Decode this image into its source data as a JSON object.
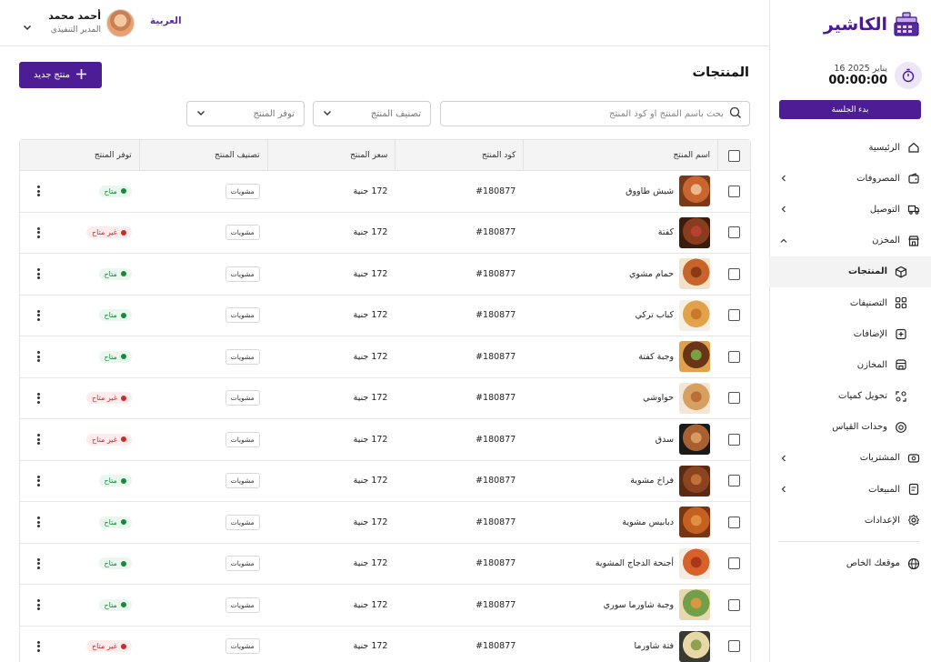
{
  "sidebar": {
    "brand": "الكاشير",
    "session": {
      "date": "16 يناير 2025",
      "time": "00:00:00",
      "start_label": "بدء الجلسة"
    },
    "items": [
      {
        "label": "الرئيسية",
        "icon": "home-icon",
        "chevron": "none",
        "level": 0,
        "active": false
      },
      {
        "label": "المصروفات",
        "icon": "wallet-icon",
        "chevron": "left",
        "level": 0,
        "active": false
      },
      {
        "label": "التوصيل",
        "icon": "truck-icon",
        "chevron": "left",
        "level": 0,
        "active": false
      },
      {
        "label": "المخزن",
        "icon": "store-icon",
        "chevron": "up",
        "level": 0,
        "active": false
      },
      {
        "label": "المنتجات",
        "icon": "box-icon",
        "chevron": "none",
        "level": 1,
        "active": true
      },
      {
        "label": "التصنيفات",
        "icon": "grid-icon",
        "chevron": "none",
        "level": 1,
        "active": false
      },
      {
        "label": "الإضافات",
        "icon": "add-square-icon",
        "chevron": "none",
        "level": 1,
        "active": false
      },
      {
        "label": "المخازن",
        "icon": "warehouse-icon",
        "chevron": "none",
        "level": 1,
        "active": false
      },
      {
        "label": "تحويل كميات",
        "icon": "transfer-icon",
        "chevron": "none",
        "level": 1,
        "active": false
      },
      {
        "label": "وحدات القياس",
        "icon": "scale-icon",
        "chevron": "none",
        "level": 1,
        "active": false
      },
      {
        "label": "المشتريات",
        "icon": "purchase-icon",
        "chevron": "left",
        "level": 0,
        "active": false
      },
      {
        "label": "المبيعات",
        "icon": "sales-icon",
        "chevron": "left",
        "level": 0,
        "active": false
      },
      {
        "label": "الإعدادات",
        "icon": "settings-icon",
        "chevron": "none",
        "level": 0,
        "active": false
      }
    ],
    "website_label": "موقعك الخاص"
  },
  "header": {
    "language": "العربية",
    "user_name": "أحمد محمد",
    "user_role": "المدير التنفيذي"
  },
  "main": {
    "title": "المنتجات",
    "new_button": "منتج جديد",
    "search_placeholder": "بحث باسم المنتج او كود المنتج",
    "category_filter": "تصنيف المنتج",
    "availability_filter": "توفر المنتج",
    "columns": [
      "اسم المنتج",
      "كود المنتج",
      "سعر المنتج",
      "تصنيف  المنتج",
      "توفر المنتج"
    ],
    "rows": [
      {
        "name": "شيش طاووق",
        "code": "#180877",
        "price": "172 جنية",
        "category": "مشويات",
        "availability": "متاح",
        "available": true,
        "thumb": [
          "#7a3a1a",
          "#c9652e",
          "#e9b98a"
        ]
      },
      {
        "name": "كفتة",
        "code": "#180877",
        "price": "172 جنية",
        "category": "مشويات",
        "availability": "غير متاح",
        "available": false,
        "thumb": [
          "#3b1d10",
          "#8a3c1e",
          "#b8402e"
        ]
      },
      {
        "name": "حمام مشوي",
        "code": "#180877",
        "price": "172 جنية",
        "category": "مشويات",
        "availability": "متاح",
        "available": true,
        "thumb": [
          "#f2e2c8",
          "#c8642a",
          "#8c3a16"
        ]
      },
      {
        "name": "كباب تركي",
        "code": "#180877",
        "price": "172 جنية",
        "category": "مشويات",
        "availability": "متاح",
        "available": true,
        "thumb": [
          "#f6f0e2",
          "#e2a24a",
          "#c87a2a"
        ]
      },
      {
        "name": "وجبة كفتة",
        "code": "#180877",
        "price": "172 جنية",
        "category": "مشويات",
        "availability": "متاح",
        "available": true,
        "thumb": [
          "#e0a24a",
          "#6a3418",
          "#7aa040"
        ]
      },
      {
        "name": "حواوشي",
        "code": "#180877",
        "price": "172 جنية",
        "category": "مشويات",
        "availability": "غير متاح",
        "available": false,
        "thumb": [
          "#f2e6d6",
          "#d8a060",
          "#b87038"
        ]
      },
      {
        "name": "سدق",
        "code": "#180877",
        "price": "172 جنية",
        "category": "مشويات",
        "availability": "غير متاح",
        "available": false,
        "thumb": [
          "#1a1a1a",
          "#a86030",
          "#d89a60"
        ]
      },
      {
        "name": "فراخ مشوية",
        "code": "#180877",
        "price": "172 جنية",
        "category": "مشويات",
        "availability": "متاح",
        "available": true,
        "thumb": [
          "#5a2a14",
          "#8a4420",
          "#c07038"
        ]
      },
      {
        "name": "دبابيس مشوية",
        "code": "#180877",
        "price": "172 جنية",
        "category": "مشويات",
        "availability": "متاح",
        "available": true,
        "thumb": [
          "#7a3410",
          "#c46020",
          "#e09040"
        ]
      },
      {
        "name": "أجنحة الدجاج المشوية",
        "code": "#180877",
        "price": "172 جنية",
        "category": "مشويات",
        "availability": "متاح",
        "available": true,
        "thumb": [
          "#f4ece0",
          "#d8602a",
          "#a83818"
        ]
      },
      {
        "name": "وجبة شاورما سوري",
        "code": "#180877",
        "price": "172 جنية",
        "category": "مشويات",
        "availability": "متاح",
        "available": true,
        "thumb": [
          "#e8d8b0",
          "#70a048",
          "#d89840"
        ]
      },
      {
        "name": "فتة شاورما",
        "code": "#180877",
        "price": "172 جنية",
        "category": "مشويات",
        "availability": "غير متاح",
        "available": false,
        "thumb": [
          "#3a3a30",
          "#e8d8a8",
          "#90a050"
        ]
      }
    ]
  },
  "colors": {
    "accent": "#4c1d95",
    "available": "#178a3a",
    "unavailable": "#c62d2d"
  }
}
